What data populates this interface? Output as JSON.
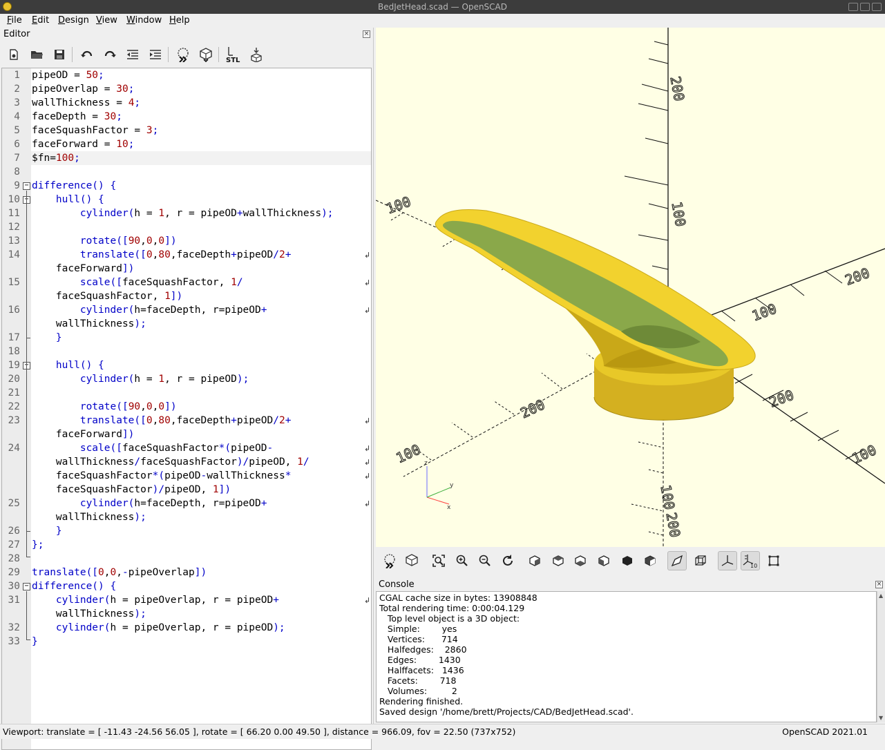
{
  "window": {
    "title": "BedJetHead.scad — OpenSCAD"
  },
  "menubar": {
    "items": [
      "File",
      "Edit",
      "Design",
      "View",
      "Window",
      "Help"
    ]
  },
  "editor": {
    "title": "Editor",
    "toolbar_icons": [
      "new-file-icon",
      "open-file-icon",
      "save-icon",
      "undo-icon",
      "redo-icon",
      "unindent-icon",
      "indent-icon",
      "preview-icon",
      "render-icon",
      "export-stl-icon",
      "send-to-printer-icon"
    ],
    "stl_label": "STL",
    "line_numbers": [
      "1",
      "2",
      "3",
      "4",
      "5",
      "6",
      "7",
      "8",
      "9",
      "10",
      "11",
      "12",
      "13",
      "14",
      "15",
      "16",
      "17",
      "18",
      "19",
      "20",
      "21",
      "22",
      "23",
      "24",
      "25",
      "26",
      "27",
      "28",
      "29",
      "30",
      "31",
      "32",
      "33"
    ]
  },
  "viewport": {
    "axis_labels": [
      "200",
      "100",
      "100",
      "100",
      "200",
      "100",
      "200",
      "100",
      "200",
      "100",
      "200"
    ],
    "gizmo": {
      "x": "x",
      "y": "y",
      "z": "z"
    },
    "model_colors": {
      "outer": "#f2d22e",
      "inner": "#8aa84a",
      "side": "#c9a818"
    }
  },
  "view_toolbar": {
    "icons": [
      "preview-icon",
      "render-icon",
      "view-all-icon",
      "zoom-in-icon",
      "zoom-out-icon",
      "reset-view-icon",
      "view-right-icon",
      "view-top-icon",
      "view-bottom-icon",
      "view-left-icon",
      "view-front-icon",
      "view-back-icon",
      "perspective-icon",
      "orthogonal-icon",
      "show-axes-icon",
      "show-scale-icon",
      "show-edges-icon"
    ],
    "scale_label": "10"
  },
  "console": {
    "title": "Console",
    "lines": [
      "CGAL cache size in bytes: 13908848",
      "Total rendering time: 0:00:04.129",
      "   Top level object is a 3D object:",
      "   Simple:        yes",
      "   Vertices:      714",
      "   Halfedges:    2860",
      "   Edges:        1430",
      "   Halffacets:   1436",
      "   Facets:        718",
      "   Volumes:         2",
      "Rendering finished.",
      "Saved design '/home/brett/Projects/CAD/BedJetHead.scad'."
    ]
  },
  "statusbar": {
    "viewport": "Viewport: translate = [ -11.43 -24.56 56.05 ], rotate = [ 66.20 0.00 49.50 ], distance = 966.09, fov = 22.50 (737x752)",
    "version": "OpenSCAD 2021.01"
  }
}
